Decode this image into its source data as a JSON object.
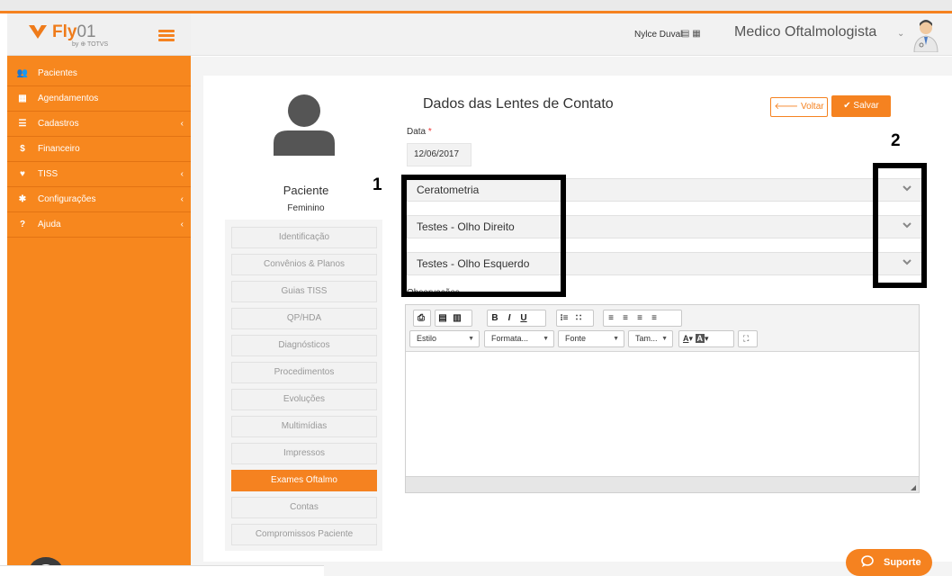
{
  "brand": {
    "logo_text": "Fly",
    "logo_suffix": "01",
    "logo_sub": "by ⊕ TOTVS"
  },
  "sidebar": {
    "items": [
      {
        "label": "Pacientes",
        "icon": "users-icon",
        "glyph": "👥",
        "has_chevron": false
      },
      {
        "label": "Agendamentos",
        "icon": "calendar-icon",
        "glyph": "▦",
        "has_chevron": false
      },
      {
        "label": "Cadastros",
        "icon": "list-icon",
        "glyph": "☰",
        "has_chevron": true
      },
      {
        "label": "Financeiro",
        "icon": "dollar-icon",
        "glyph": "$",
        "has_chevron": false
      },
      {
        "label": "TISS",
        "icon": "heartbeat-icon",
        "glyph": "♥",
        "has_chevron": true
      },
      {
        "label": "Configurações",
        "icon": "gear-icon",
        "glyph": "✱",
        "has_chevron": true
      },
      {
        "label": "Ajuda",
        "icon": "question-icon",
        "glyph": "?",
        "has_chevron": true
      }
    ]
  },
  "header": {
    "user_name": "Nylce Duval",
    "role": "Medico Oftalmologista"
  },
  "patient": {
    "label": "Paciente",
    "gender": "Feminino"
  },
  "patient_nav": [
    {
      "label": "Identificação",
      "active": false
    },
    {
      "label": "Convênios & Planos",
      "active": false
    },
    {
      "label": "Guias TISS",
      "active": false
    },
    {
      "label": "QP/HDA",
      "active": false
    },
    {
      "label": "Diagnósticos",
      "active": false
    },
    {
      "label": "Procedimentos",
      "active": false
    },
    {
      "label": "Evoluções",
      "active": false
    },
    {
      "label": "Multimídias",
      "active": false
    },
    {
      "label": "Impressos",
      "active": false
    },
    {
      "label": "Exames Oftalmo",
      "active": true
    },
    {
      "label": "Contas",
      "active": false
    },
    {
      "label": "Compromissos Paciente",
      "active": false
    }
  ],
  "form": {
    "title": "Dados das Lentes de Contato",
    "back_label": "Voltar",
    "save_label": "Salvar",
    "date_label": "Data",
    "required_mark": "*",
    "date_value": "12/06/2017",
    "panels": [
      "Ceratometria",
      "Testes - Olho Direito",
      "Testes - Olho Esquerdo"
    ],
    "obs_label": "Observações"
  },
  "editor": {
    "combos": [
      {
        "label": "Estilo"
      },
      {
        "label": "Formata..."
      },
      {
        "label": "Fonte"
      },
      {
        "label": "Tam..."
      }
    ]
  },
  "annotations": {
    "one": "1",
    "two": "2"
  },
  "support": {
    "label": "Suporte"
  },
  "colors": {
    "accent": "#f58220",
    "sidebar": "#f7871e"
  }
}
